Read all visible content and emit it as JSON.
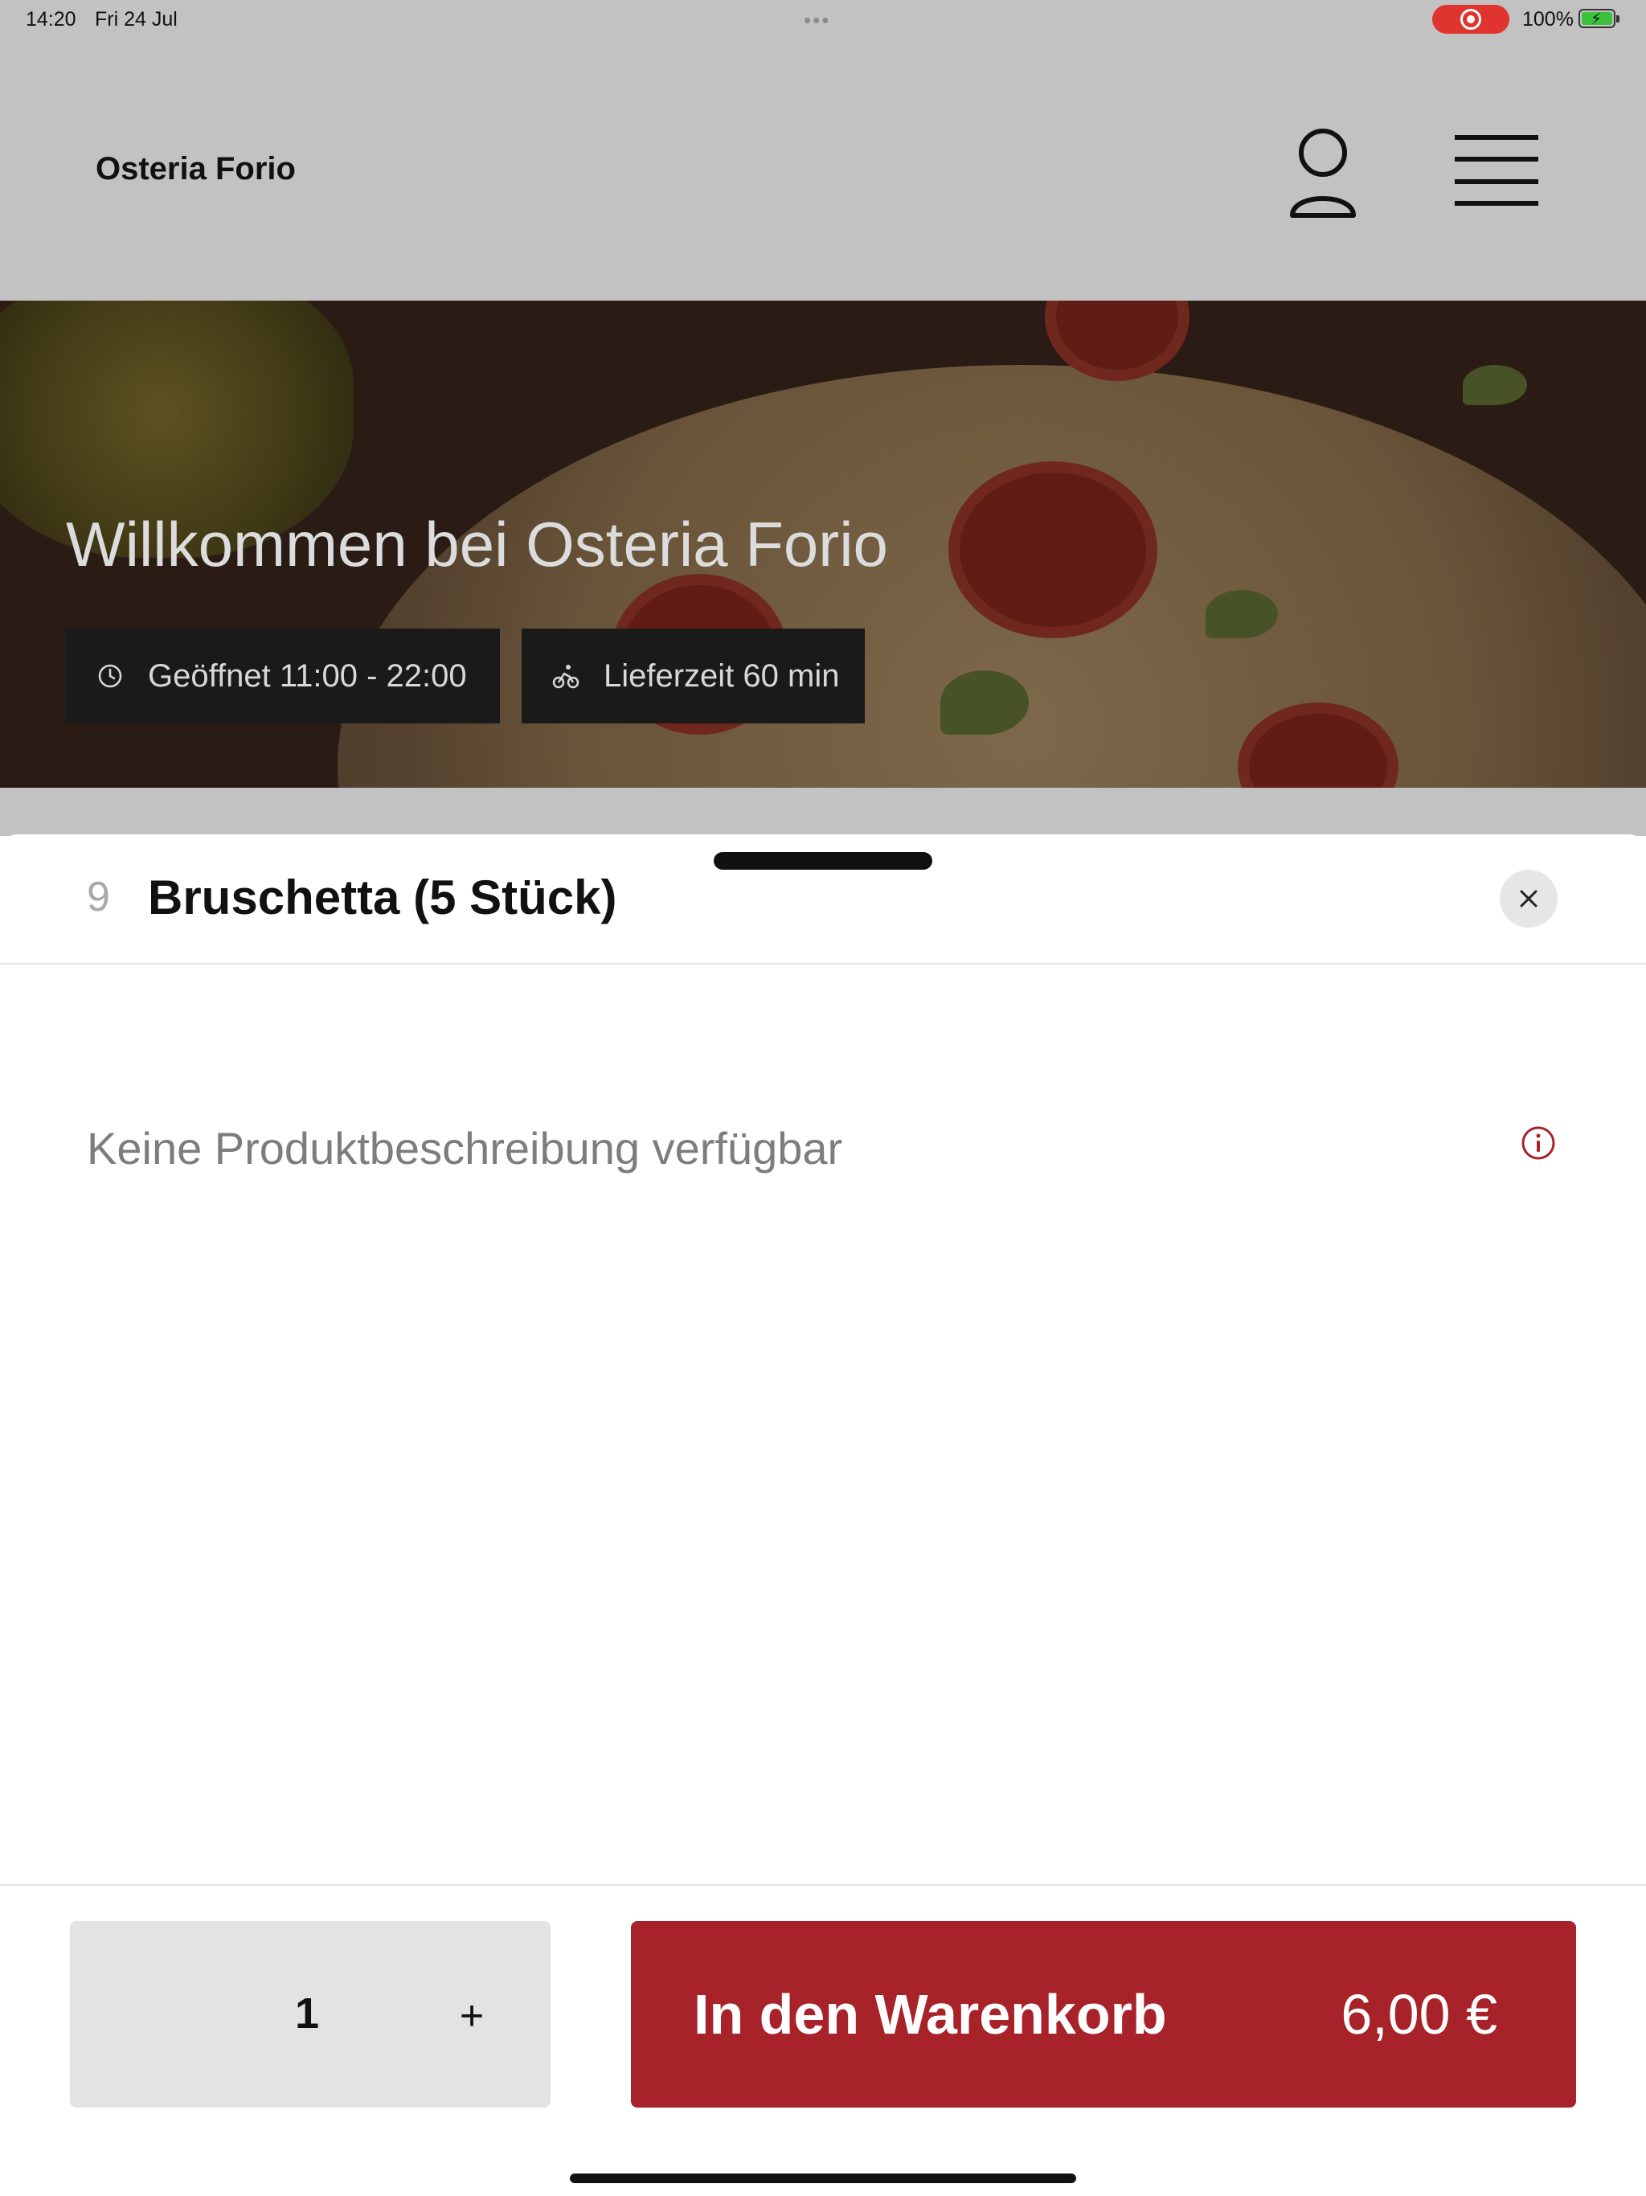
{
  "status_bar": {
    "time": "14:20",
    "date": "Fri 24 Jul",
    "dots": "•••",
    "battery_percent": "100%",
    "battery_level": 1.0
  },
  "header": {
    "brand": "Osteria Forio",
    "user_icon": "user-icon",
    "menu_icon": "hamburger-menu-icon"
  },
  "hero": {
    "title": "Willkommen bei Osteria Forio",
    "opening_hours": "Geöffnet 11:00 - 22:00",
    "delivery_time": "Lieferzeit 60 min",
    "opening_icon": "clock-icon",
    "delivery_icon": "bicycle-icon"
  },
  "product_sheet": {
    "number": "9",
    "title": "Bruschetta (5 Stück)",
    "close_icon": "close-icon",
    "description": "Keine Produktbeschreibung verfügbar",
    "info_icon": "info-icon",
    "quantity": "1",
    "plus_label": "+",
    "add_to_cart_label": "In den Warenkorb",
    "price": "6,00 €"
  },
  "colors": {
    "accent": "#a8222a",
    "info_icon": "#a8222a",
    "backdrop": "#c2c2c2",
    "recording_pill": "#e0342f"
  }
}
